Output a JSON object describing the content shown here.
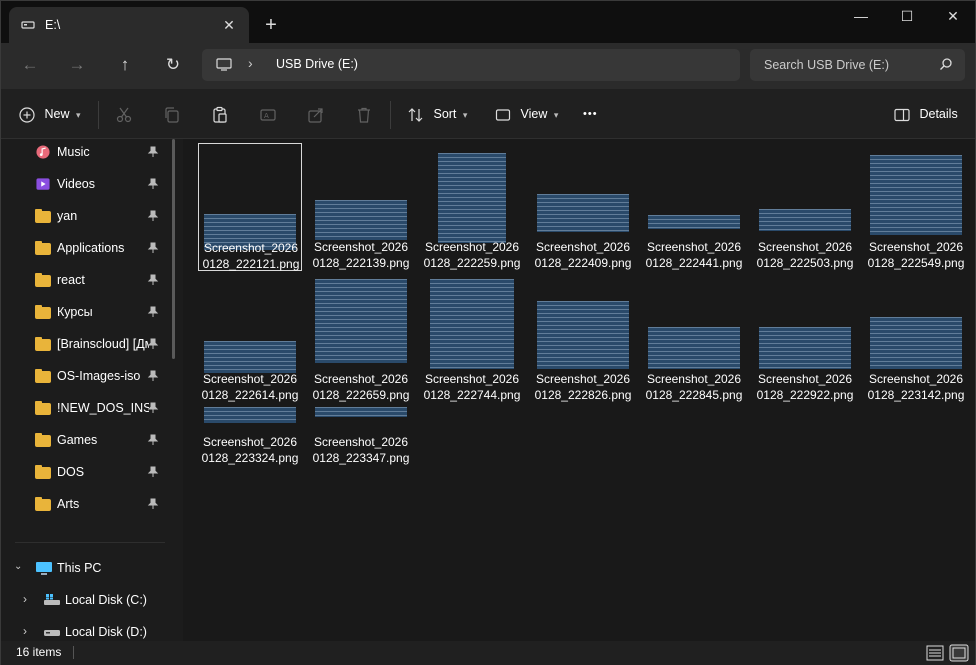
{
  "window": {
    "tab_title": "E:\\",
    "close_tab": "✕",
    "new_tab": "+",
    "minimize": "—",
    "maximize": "☐",
    "close": "✕"
  },
  "nav": {
    "back": "←",
    "forward": "→",
    "up": "↑",
    "refresh": "↻"
  },
  "address": {
    "chevron": "›",
    "crumb": "USB Drive (E:)"
  },
  "search": {
    "placeholder": "Search USB Drive (E:)"
  },
  "toolbar": {
    "new_label": "New",
    "sort_label": "Sort",
    "view_label": "View",
    "more_label": "•••",
    "details_label": "Details"
  },
  "sidebar": {
    "items": [
      {
        "label": "Music",
        "icon": "music-icon"
      },
      {
        "label": "Videos",
        "icon": "videos-icon"
      },
      {
        "label": "yan",
        "icon": "folder-icon"
      },
      {
        "label": "Applications",
        "icon": "folder-icon"
      },
      {
        "label": "react",
        "icon": "folder-icon"
      },
      {
        "label": "Курсы",
        "icon": "folder-icon"
      },
      {
        "label": "[Brainscloud] [Дм",
        "icon": "folder-icon"
      },
      {
        "label": "OS-Images-iso",
        "icon": "folder-icon"
      },
      {
        "label": "!NEW_DOS_INSTA",
        "icon": "folder-icon"
      },
      {
        "label": "Games",
        "icon": "folder-icon"
      },
      {
        "label": "DOS",
        "icon": "folder-icon"
      },
      {
        "label": "Arts",
        "icon": "folder-icon"
      }
    ],
    "this_pc": "This PC",
    "drives": [
      {
        "label": "Local Disk (C:)"
      },
      {
        "label": "Local Disk (D:)"
      }
    ]
  },
  "files": [
    {
      "line1": "Screenshot_2026",
      "line2": "0128_222121.png"
    },
    {
      "line1": "Screenshot_2026",
      "line2": "0128_222139.png"
    },
    {
      "line1": "Screenshot_2026",
      "line2": "0128_222259.png"
    },
    {
      "line1": "Screenshot_2026",
      "line2": "0128_222409.png"
    },
    {
      "line1": "Screenshot_2026",
      "line2": "0128_222441.png"
    },
    {
      "line1": "Screenshot_2026",
      "line2": "0128_222503.png"
    },
    {
      "line1": "Screenshot_2026",
      "line2": "0128_222549.png"
    },
    {
      "line1": "Screenshot_2026",
      "line2": "0128_222614.png"
    },
    {
      "line1": "Screenshot_2026",
      "line2": "0128_222659.png"
    },
    {
      "line1": "Screenshot_2026",
      "line2": "0128_222744.png"
    },
    {
      "line1": "Screenshot_2026",
      "line2": "0128_222826.png"
    },
    {
      "line1": "Screenshot_2026",
      "line2": "0128_222845.png"
    },
    {
      "line1": "Screenshot_2026",
      "line2": "0128_222922.png"
    },
    {
      "line1": "Screenshot_2026",
      "line2": "0128_223142.png"
    },
    {
      "line1": "Screenshot_2026",
      "line2": "0128_223324.png"
    },
    {
      "line1": "Screenshot_2026",
      "line2": "0128_223347.png"
    }
  ],
  "status": {
    "item_count": "16 items"
  },
  "colors": {
    "folder": "#e9b43a",
    "thumb_bg": "#2a4a6a",
    "accent": "#4cc2ff"
  }
}
